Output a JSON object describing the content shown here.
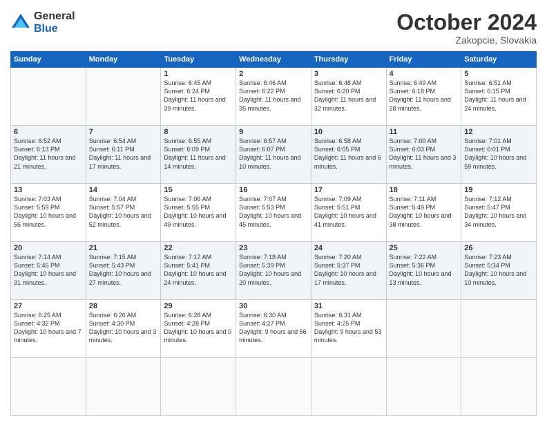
{
  "logo": {
    "general": "General",
    "blue": "Blue"
  },
  "header": {
    "month": "October 2024",
    "location": "Zakopcie, Slovakia"
  },
  "weekdays": [
    "Sunday",
    "Monday",
    "Tuesday",
    "Wednesday",
    "Thursday",
    "Friday",
    "Saturday"
  ],
  "days": [
    {
      "num": "",
      "empty": true
    },
    {
      "num": "",
      "empty": true
    },
    {
      "num": "1",
      "rise": "6:45 AM",
      "set": "6:24 PM",
      "daylight": "11 hours and 39 minutes."
    },
    {
      "num": "2",
      "rise": "6:46 AM",
      "set": "6:22 PM",
      "daylight": "11 hours and 35 minutes."
    },
    {
      "num": "3",
      "rise": "6:48 AM",
      "set": "6:20 PM",
      "daylight": "11 hours and 32 minutes."
    },
    {
      "num": "4",
      "rise": "6:49 AM",
      "set": "6:18 PM",
      "daylight": "11 hours and 28 minutes."
    },
    {
      "num": "5",
      "rise": "6:51 AM",
      "set": "6:15 PM",
      "daylight": "11 hours and 24 minutes."
    },
    {
      "num": "6",
      "rise": "6:52 AM",
      "set": "6:13 PM",
      "daylight": "11 hours and 21 minutes."
    },
    {
      "num": "7",
      "rise": "6:54 AM",
      "set": "6:11 PM",
      "daylight": "11 hours and 17 minutes."
    },
    {
      "num": "8",
      "rise": "6:55 AM",
      "set": "6:09 PM",
      "daylight": "11 hours and 14 minutes."
    },
    {
      "num": "9",
      "rise": "6:57 AM",
      "set": "6:07 PM",
      "daylight": "11 hours and 10 minutes."
    },
    {
      "num": "10",
      "rise": "6:58 AM",
      "set": "6:05 PM",
      "daylight": "11 hours and 6 minutes."
    },
    {
      "num": "11",
      "rise": "7:00 AM",
      "set": "6:03 PM",
      "daylight": "11 hours and 3 minutes."
    },
    {
      "num": "12",
      "rise": "7:01 AM",
      "set": "6:01 PM",
      "daylight": "10 hours and 59 minutes."
    },
    {
      "num": "13",
      "rise": "7:03 AM",
      "set": "5:59 PM",
      "daylight": "10 hours and 56 minutes."
    },
    {
      "num": "14",
      "rise": "7:04 AM",
      "set": "5:57 PM",
      "daylight": "10 hours and 52 minutes."
    },
    {
      "num": "15",
      "rise": "7:06 AM",
      "set": "5:55 PM",
      "daylight": "10 hours and 49 minutes."
    },
    {
      "num": "16",
      "rise": "7:07 AM",
      "set": "5:53 PM",
      "daylight": "10 hours and 45 minutes."
    },
    {
      "num": "17",
      "rise": "7:09 AM",
      "set": "5:51 PM",
      "daylight": "10 hours and 41 minutes."
    },
    {
      "num": "18",
      "rise": "7:11 AM",
      "set": "5:49 PM",
      "daylight": "10 hours and 38 minutes."
    },
    {
      "num": "19",
      "rise": "7:12 AM",
      "set": "5:47 PM",
      "daylight": "10 hours and 34 minutes."
    },
    {
      "num": "20",
      "rise": "7:14 AM",
      "set": "5:45 PM",
      "daylight": "10 hours and 31 minutes."
    },
    {
      "num": "21",
      "rise": "7:15 AM",
      "set": "5:43 PM",
      "daylight": "10 hours and 27 minutes."
    },
    {
      "num": "22",
      "rise": "7:17 AM",
      "set": "5:41 PM",
      "daylight": "10 hours and 24 minutes."
    },
    {
      "num": "23",
      "rise": "7:18 AM",
      "set": "5:39 PM",
      "daylight": "10 hours and 20 minutes."
    },
    {
      "num": "24",
      "rise": "7:20 AM",
      "set": "5:37 PM",
      "daylight": "10 hours and 17 minutes."
    },
    {
      "num": "25",
      "rise": "7:22 AM",
      "set": "5:36 PM",
      "daylight": "10 hours and 13 minutes."
    },
    {
      "num": "26",
      "rise": "7:23 AM",
      "set": "5:34 PM",
      "daylight": "10 hours and 10 minutes."
    },
    {
      "num": "27",
      "rise": "6:25 AM",
      "set": "4:32 PM",
      "daylight": "10 hours and 7 minutes."
    },
    {
      "num": "28",
      "rise": "6:26 AM",
      "set": "4:30 PM",
      "daylight": "10 hours and 3 minutes."
    },
    {
      "num": "29",
      "rise": "6:28 AM",
      "set": "4:28 PM",
      "daylight": "10 hours and 0 minutes."
    },
    {
      "num": "30",
      "rise": "6:30 AM",
      "set": "4:27 PM",
      "daylight": "9 hours and 56 minutes."
    },
    {
      "num": "31",
      "rise": "6:31 AM",
      "set": "4:25 PM",
      "daylight": "9 hours and 53 minutes."
    },
    {
      "num": "",
      "empty": true
    },
    {
      "num": "",
      "empty": true
    }
  ]
}
